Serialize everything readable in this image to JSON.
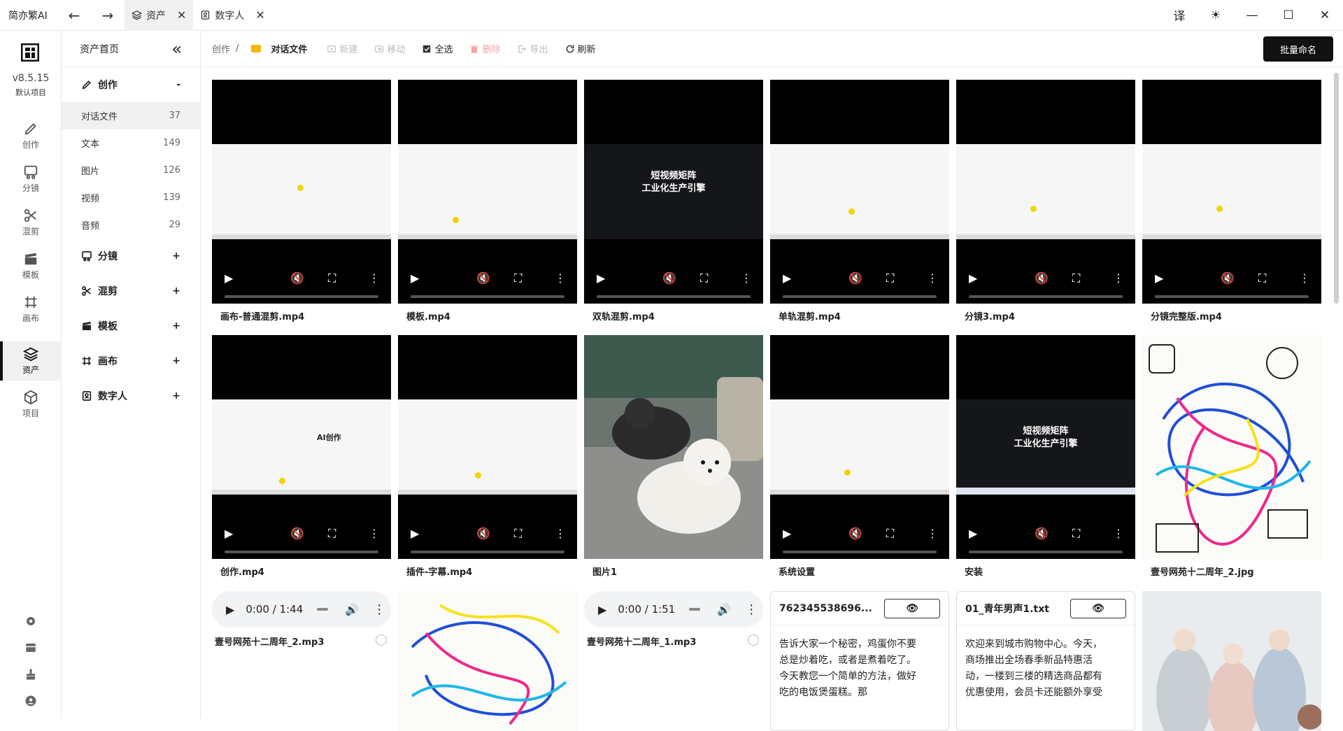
{
  "app": {
    "name": "简亦繁AI"
  },
  "tabs": [
    {
      "label": "资产",
      "icon": "layers-icon",
      "active": true
    },
    {
      "label": "数字人",
      "icon": "portrait-icon",
      "active": false
    }
  ],
  "window_controls": {
    "translate": "译",
    "theme": "☀",
    "minimize": "—",
    "maximize": "☐",
    "close": "✕"
  },
  "rail": {
    "version": "v8.5.15",
    "project": "默认项目",
    "items": [
      {
        "label": "创作",
        "icon": "pencil-icon"
      },
      {
        "label": "分镜",
        "icon": "storyboard-icon"
      },
      {
        "label": "混剪",
        "icon": "scissors-icon"
      },
      {
        "label": "模板",
        "icon": "clapper-icon"
      },
      {
        "label": "画布",
        "icon": "canvas-icon"
      },
      {
        "label": "资产",
        "icon": "layers-icon",
        "active": true
      },
      {
        "label": "项目",
        "icon": "box-icon"
      }
    ],
    "bottom_icons": [
      "gear-icon",
      "card-icon",
      "broom-icon",
      "user-icon"
    ]
  },
  "sidebar": {
    "title": "资产首页",
    "collapse_icon": "«",
    "groups": [
      {
        "label": "创作",
        "icon": "pencil-icon",
        "toggle": "-",
        "children": [
          {
            "label": "对话文件",
            "count": "37",
            "active": true
          },
          {
            "label": "文本",
            "count": "149"
          },
          {
            "label": "图片",
            "count": "126"
          },
          {
            "label": "视频",
            "count": "139"
          },
          {
            "label": "音频",
            "count": "29"
          }
        ]
      },
      {
        "label": "分镜",
        "icon": "storyboard-icon",
        "toggle": "+"
      },
      {
        "label": "混剪",
        "icon": "scissors-icon",
        "toggle": "+"
      },
      {
        "label": "模板",
        "icon": "clapper-icon",
        "toggle": "+"
      },
      {
        "label": "画布",
        "icon": "canvas-icon",
        "toggle": "+"
      },
      {
        "label": "数字人",
        "icon": "portrait-icon",
        "toggle": "+"
      }
    ]
  },
  "toolbar": {
    "crumb_root": "创作",
    "crumb_sep": "/",
    "crumb_current": "对话文件",
    "buttons": [
      {
        "label": "新建",
        "enabled": false
      },
      {
        "label": "移动",
        "enabled": false
      },
      {
        "label": "全选",
        "enabled": true
      },
      {
        "label": "删除",
        "enabled": false
      },
      {
        "label": "导出",
        "enabled": false
      },
      {
        "label": "刷新",
        "enabled": true
      }
    ],
    "rename_label": "批量命名"
  },
  "grid": {
    "row1": [
      "画布-普通混剪.mp4",
      "模板.mp4",
      "双轨混剪.mp4",
      "单轨混剪.mp4",
      "分镜3.mp4",
      "分镜完整版.mp4"
    ],
    "row2": [
      "创作.mp4",
      "插件-字幕.mp4",
      "图片1",
      "系统设置",
      "安装",
      "壹号网苑十二周年_2.jpg"
    ],
    "thumb_text": {
      "hero_line1": "短视频矩阵",
      "hero_line2": "工业化生产引擎",
      "ai_logo": "AI创作"
    },
    "row3": {
      "audio1": {
        "time": "0:00 / 1:44",
        "name": "壹号网苑十二周年_2.mp3"
      },
      "audio2": {
        "time": "0:00 / 1:51",
        "name": "壹号网苑十二周年_1.mp3"
      },
      "text1": {
        "title": "762345538696...",
        "body": "告诉大家一个秘密，鸡蛋你不要总是炒着吃，或者是煮着吃了。今天教您一个简单的方法，做好吃的电饭煲蛋糕。那"
      },
      "text2": {
        "title": "01_青年男声1.txt",
        "body": "欢迎来到城市购物中心。今天，商场推出全场春季新品特惠活动，一楼到三楼的精选商品都有优惠使用，会员卡还能额外享受"
      }
    }
  }
}
